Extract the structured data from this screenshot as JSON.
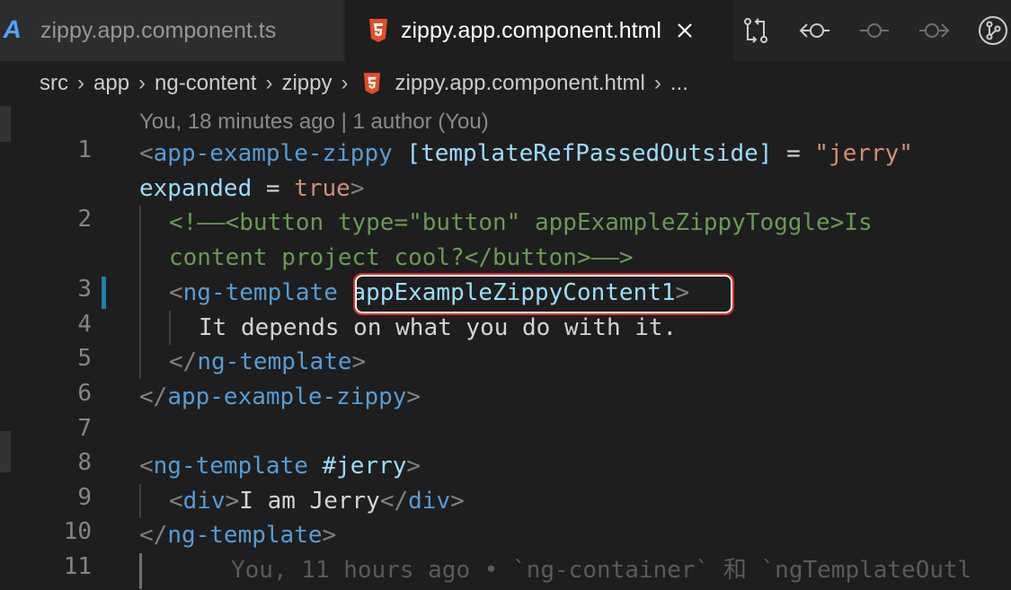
{
  "tabs": [
    {
      "label": "zippy.app.component.ts",
      "active": false,
      "icon": "angular-icon"
    },
    {
      "label": "zippy.app.component.html",
      "active": true,
      "icon": "html5-icon"
    }
  ],
  "actions": [
    "compare-changes-icon",
    "previous-change-icon",
    "git-commit-icon",
    "next-change-icon",
    "git-graph-icon"
  ],
  "breadcrumb": [
    "src",
    "app",
    "ng-content",
    "zippy",
    "zippy.app.component.html",
    "..."
  ],
  "blame_header": "You, 18 minutes ago | 1 author (You)",
  "line_numbers": [
    "1",
    "2",
    "3",
    "4",
    "5",
    "6",
    "7",
    "8",
    "9",
    "10",
    "11"
  ],
  "code": {
    "l1a": {
      "p1": "<",
      "tag": "app-example-zippy",
      "sp": " ",
      "attr": "[templateRefPassedOutside]",
      "eq": " = ",
      "str": "\"jerry\""
    },
    "l1b": {
      "attr": "expanded",
      "eq": " = ",
      "str": "true",
      "p2": ">"
    },
    "l2a": "<!——<button type=\"button\" appExampleZippyToggle>Is",
    "l2b": "content project cool?</button>——>",
    "l3": {
      "p1": "<",
      "tag": "ng-template",
      "sp": " ",
      "attr": "appExampleZippyContent1",
      "p2": ">"
    },
    "l4": "It depends on what you do with it.",
    "l5": {
      "p1": "</",
      "tag": "ng-template",
      "p2": ">"
    },
    "l6": {
      "p1": "</",
      "tag": "app-example-zippy",
      "p2": ">"
    },
    "l8": {
      "p1": "<",
      "tag": "ng-template",
      "sp": " ",
      "attr": "#jerry",
      "p2": ">"
    },
    "l9": {
      "p1": "<",
      "tag": "div",
      "p2": ">",
      "text": "I am Jerry",
      "p3": "</",
      "tag2": "div",
      "p4": ">"
    },
    "l10": {
      "p1": "</",
      "tag": "ng-template",
      "p2": ">"
    },
    "l11_blame": "You, 11 hours ago • `ng-container` 和 `ngTemplateOutl"
  },
  "colors": {
    "tag": "#569cd6",
    "attr": "#9cdcfe",
    "string": "#ce9178",
    "comment": "#6a9955",
    "highlight": "#e02c2c"
  }
}
